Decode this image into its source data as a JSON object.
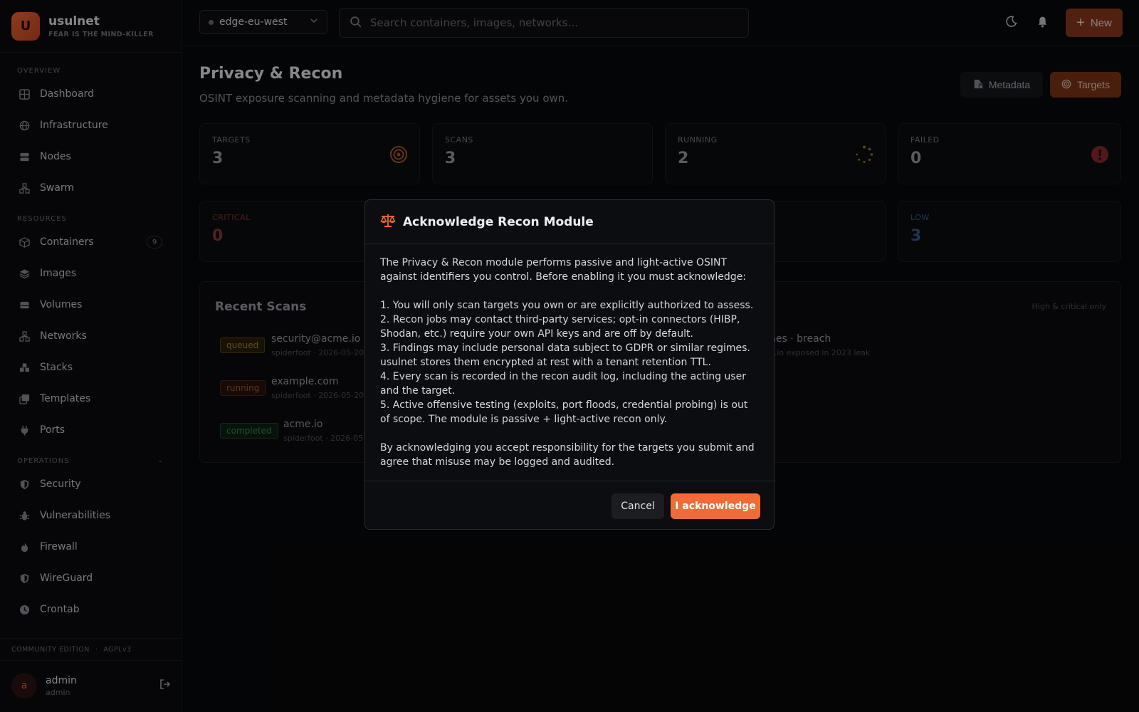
{
  "app": {
    "name": "usulnet",
    "tagline": "FEAR IS THE MIND-KILLER",
    "logo_letter": "U"
  },
  "sidebar": {
    "sections": [
      {
        "title": "OVERVIEW",
        "items": [
          {
            "label": "Dashboard",
            "icon": "grid-icon"
          },
          {
            "label": "Infrastructure",
            "icon": "globe-icon"
          },
          {
            "label": "Nodes",
            "icon": "server-icon"
          },
          {
            "label": "Swarm",
            "icon": "swarm-icon"
          }
        ]
      },
      {
        "title": "RESOURCES",
        "items": [
          {
            "label": "Containers",
            "icon": "box-icon",
            "badge": "9"
          },
          {
            "label": "Images",
            "icon": "layers-icon"
          },
          {
            "label": "Volumes",
            "icon": "disk-icon"
          },
          {
            "label": "Networks",
            "icon": "network-icon"
          },
          {
            "label": "Stacks",
            "icon": "stack-icon"
          },
          {
            "label": "Templates",
            "icon": "template-icon"
          },
          {
            "label": "Ports",
            "icon": "plug-icon"
          }
        ]
      },
      {
        "title": "OPERATIONS",
        "items": [
          {
            "label": "Security",
            "icon": "shield-icon"
          },
          {
            "label": "Vulnerabilities",
            "icon": "bug-icon"
          },
          {
            "label": "Firewall",
            "icon": "flame-icon"
          },
          {
            "label": "WireGuard",
            "icon": "shield-icon"
          },
          {
            "label": "Crontab",
            "icon": "clock-icon"
          }
        ]
      }
    ],
    "edition": "COMMUNITY EDITION",
    "license": "AGPLv3",
    "user": {
      "initial": "a",
      "name": "admin",
      "role": "admin"
    }
  },
  "topbar": {
    "environment": "edge-eu-west",
    "search_placeholder": "Search containers, images, networks…",
    "new_label": "New"
  },
  "page": {
    "title": "Privacy & Recon",
    "subtitle": "OSINT exposure scanning and metadata hygiene for assets you own.",
    "metadata_button": "Metadata",
    "targets_button": "Targets"
  },
  "stats": [
    {
      "label": "TARGETS",
      "value": "3"
    },
    {
      "label": "SCANS",
      "value": "3"
    },
    {
      "label": "RUNNING",
      "value": "2"
    },
    {
      "label": "FAILED",
      "value": "0"
    }
  ],
  "severity": [
    {
      "label": "CRITICAL",
      "value": "0",
      "color": "#8a3030"
    },
    {
      "label": "LOW",
      "value": "3",
      "color": "#3a5a8c"
    }
  ],
  "recent": {
    "title": "Recent Scans",
    "hint": "High & critical only",
    "scans": [
      {
        "status": "queued",
        "name": "security@acme.io",
        "meta": "spiderfoot · 2026-05-20"
      },
      {
        "status": "running",
        "name": "example.com",
        "meta": "spiderfoot · 2026-05-20"
      },
      {
        "status": "completed",
        "name": "acme.io",
        "meta": "spiderfoot · 2026-05"
      }
    ],
    "finding": {
      "title": "nes · breach",
      "meta": "e.io exposed in 2023 leak"
    }
  },
  "modal": {
    "title": "Acknowledge Recon Module",
    "intro": "The Privacy & Recon module performs passive and light-active OSINT against identifiers you control. Before enabling it you must acknowledge:",
    "points": [
      "1. You will only scan targets you own or are explicitly authorized to assess.",
      "2. Recon jobs may contact third-party services; opt-in connectors (HIBP, Shodan, etc.) require your own API keys and are off by default.",
      "3. Findings may include personal data subject to GDPR or similar regimes. usulnet stores them encrypted at rest with a tenant retention TTL.",
      "4. Every scan is recorded in the recon audit log, including the acting user and the target.",
      "5. Active offensive testing (exploits, port floods, credential probing) is out of scope. The module is passive + light-active recon only."
    ],
    "outro": "By acknowledging you accept responsibility for the targets you submit and agree that misuse may be logged and audited.",
    "cancel_label": "Cancel",
    "ack_label": "I acknowledge"
  },
  "colors": {
    "accent": "#f26a38",
    "background": "#08090b"
  }
}
